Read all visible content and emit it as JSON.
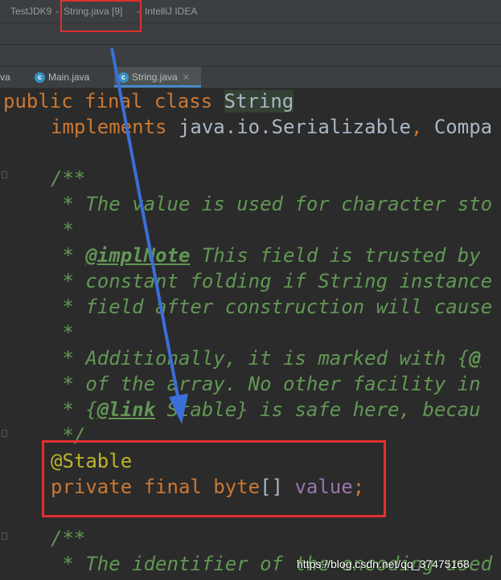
{
  "window": {
    "project": "TestJDK9",
    "sep1": " - ",
    "file_title": "String.java [9]",
    "sep2": " - ",
    "app": "IntelliJ IDEA"
  },
  "tabs": [
    {
      "label": "va",
      "icon": "java-class-icon",
      "active": false
    },
    {
      "label": "Main.java",
      "icon": "java-class-icon",
      "active": false
    },
    {
      "label": "String.java",
      "icon": "java-class-icon",
      "active": true
    }
  ],
  "code": {
    "l1": {
      "kw": "public final class ",
      "name": "String"
    },
    "l2": {
      "kw": "implements ",
      "rest": "java.io.Serializable",
      "comma": ", ",
      "tail": "Compa"
    },
    "l3": {
      "text": "/**"
    },
    "l4": {
      "text": " * The value is used for character sto"
    },
    "l5": {
      "text": " *"
    },
    "l6": {
      "pre": " * ",
      "tag": "@implNote",
      "post": " This field is trusted by"
    },
    "l7": {
      "text": " * constant folding if String instance"
    },
    "l8": {
      "text": " * field after construction will cause"
    },
    "l9": {
      "text": " *"
    },
    "l10": {
      "pre": " * Additionally, it is marked with {",
      "tag": "@"
    },
    "l11": {
      "text": " * of the array. No other facility in"
    },
    "l12": {
      "pre": " * {",
      "tag": "@link",
      "post": " Stable} is safe here, becau"
    },
    "l13": {
      "text": " */"
    },
    "l14": {
      "text": "@Stable"
    },
    "l15": {
      "kw": "private final byte",
      "brackets": "[] ",
      "field": "value",
      "semi": ";"
    },
    "l16": {
      "text": "/**"
    },
    "l17": {
      "text": " * The identifier of the encoding used"
    }
  },
  "watermark": "https://blog.csdn.net/qq_37475168",
  "colors": {
    "keyword": "#cc7832",
    "doc_comment": "#629755",
    "annotation": "#bbb529",
    "field": "#9876aa",
    "highlight_box": "#e03030",
    "arrow": "#3a6fd8"
  }
}
